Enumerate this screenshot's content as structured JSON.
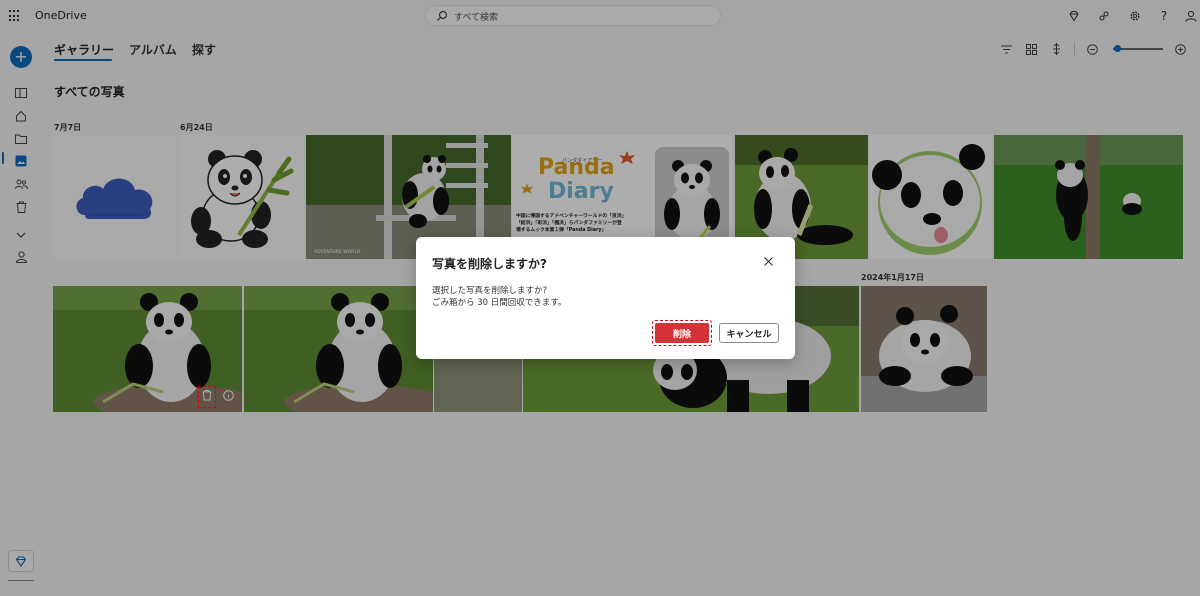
{
  "app": {
    "name": "OneDrive"
  },
  "search": {
    "placeholder": "すべて検索"
  },
  "nav": {
    "tabs": [
      "ギャラリー",
      "アルバム",
      "探す"
    ],
    "active_tab": "ギャラリー"
  },
  "gallery": {
    "section_title": "すべての写真",
    "dates": [
      "7月7日",
      "6月24日",
      "2024年1月17日"
    ]
  },
  "dialog": {
    "title": "写真を削除しますか?",
    "line1": "選択した写真を削除しますか?",
    "line2": "ごみ箱から 30 日間回収できます。",
    "delete_label": "削除",
    "cancel_label": "キャンセル"
  },
  "book": {
    "sub": "パンダダイアリー",
    "title1": "Panda",
    "title2": "Diary",
    "caption1": "中国に帰国するアドベンチャーワールドの「良浜」",
    "caption2": "「結浜」「彩浜」「楓浜」らパンダファミリーが登",
    "caption3": "場するムック本第１弾「Panda Diary」"
  },
  "photo_badge": "ADVENTURE WORLD",
  "colors": {
    "accent": "#0f6cbd",
    "danger": "#d13438"
  }
}
